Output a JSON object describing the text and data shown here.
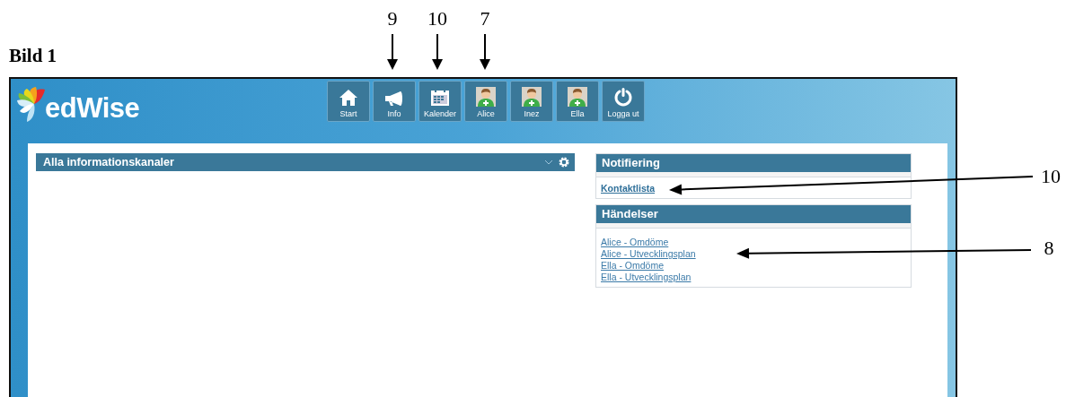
{
  "caption": "Bild 1",
  "callouts": [
    {
      "label": "9",
      "kind": "down"
    },
    {
      "label": "10",
      "kind": "down"
    },
    {
      "label": "7",
      "kind": "down"
    },
    {
      "label": "10",
      "kind": "left"
    },
    {
      "label": "8",
      "kind": "left"
    }
  ],
  "app": {
    "logo": "edWise",
    "toolbar": [
      {
        "label": "Start",
        "kind": "home"
      },
      {
        "label": "Info",
        "kind": "megaphone"
      },
      {
        "label": "Kalender",
        "kind": "calendar"
      },
      {
        "label": "Alice",
        "kind": "person"
      },
      {
        "label": "Inez",
        "kind": "person"
      },
      {
        "label": "Ella",
        "kind": "person"
      },
      {
        "label": "Logga ut",
        "kind": "power"
      }
    ],
    "main_panel": {
      "title": "Alla informationskanaler"
    },
    "side_panels": [
      {
        "title": "Notifiering",
        "links": [
          {
            "text": "Kontaktlista",
            "bold": true
          }
        ]
      },
      {
        "title": "Händelser",
        "links": [
          {
            "text": "Alice - Omdöme",
            "bold": false
          },
          {
            "text": "Alice - Utvecklingsplan",
            "bold": false
          },
          {
            "text": "Ella - Omdöme",
            "bold": false
          },
          {
            "text": "Ella - Utvecklingsplan",
            "bold": false
          }
        ]
      }
    ]
  }
}
